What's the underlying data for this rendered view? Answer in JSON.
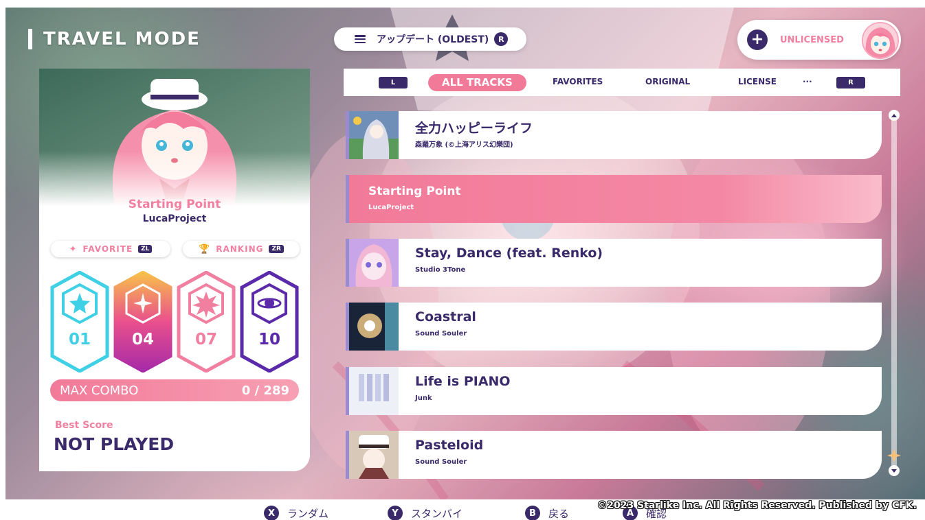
{
  "header": {
    "mode_title": "TRAVEL MODE",
    "sort_label": "アップデート (OLDEST)",
    "sort_badge": "R",
    "user_status": "UNLICENSED",
    "plus_glyph": "+"
  },
  "info_panel": {
    "song_title": "Starting Point",
    "song_artist": "LucaProject",
    "favorite_label": "FAVORITE",
    "favorite_key": "ZL",
    "ranking_label": "RANKING",
    "ranking_key": "ZR",
    "difficulties": [
      {
        "level": "01",
        "color": "#3fd0e6"
      },
      {
        "level": "04",
        "color": "#c23fa8"
      },
      {
        "level": "07",
        "color": "#f07fa0"
      },
      {
        "level": "10",
        "color": "#5a2aa8"
      }
    ],
    "max_combo_label": "MAX COMBO",
    "max_combo_value": "0 / 289",
    "best_score_label": "Best Score",
    "best_score_value": "NOT PLAYED"
  },
  "tabs": {
    "left_key": "L",
    "right_key": "R",
    "items": [
      {
        "label": "ALL TRACKS"
      },
      {
        "label": "FAVORITES"
      },
      {
        "label": "ORIGINAL"
      },
      {
        "label": "LICENSE"
      },
      {
        "label": "···"
      }
    ]
  },
  "tracks": [
    {
      "title": "全力ハッピーライフ",
      "artist": "森羅万象 (©上海アリス幻樂団)"
    },
    {
      "title": "Starting Point",
      "artist": "LucaProject"
    },
    {
      "title": "Stay, Dance (feat. Renko)",
      "artist": "Studio 3Tone"
    },
    {
      "title": "Coastral",
      "artist": "Sound Souler"
    },
    {
      "title": "Life is PIANO",
      "artist": "Junk"
    },
    {
      "title": "Pasteloid",
      "artist": "Sound Souler"
    }
  ],
  "footer": {
    "hints": [
      {
        "key": "X",
        "label": "ランダム"
      },
      {
        "key": "Y",
        "label": "スタンバイ"
      },
      {
        "key": "B",
        "label": "戻る"
      },
      {
        "key": "A",
        "label": "確認"
      }
    ],
    "copyright": "©2023 Starlike Inc. All Rights Reserved. Published by CFK."
  },
  "colors": {
    "accent_pink": "#f27a99",
    "navy": "#3a2a6a",
    "selected_edge": "#9a8ad0"
  }
}
